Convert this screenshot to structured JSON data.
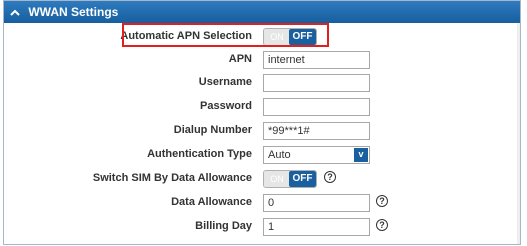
{
  "section": {
    "title": "WWAN Settings",
    "collapse_icon": "chevron-up-icon"
  },
  "rows": {
    "auto_apn": {
      "label": "Automatic APN Selection",
      "toggle_on": "ON",
      "toggle_off": "OFF",
      "state": "OFF"
    },
    "apn": {
      "label": "APN",
      "value": "internet"
    },
    "username": {
      "label": "Username",
      "value": ""
    },
    "password": {
      "label": "Password",
      "value": ""
    },
    "dialup": {
      "label": "Dialup Number",
      "value": "*99***1#"
    },
    "auth": {
      "label": "Authentication Type",
      "value": "Auto",
      "arrow": "v"
    },
    "switch_sim": {
      "label": "Switch SIM By Data Allowance",
      "toggle_on": "ON",
      "toggle_off": "OFF",
      "state": "OFF",
      "help": "?"
    },
    "data_allowance": {
      "label": "Data Allowance",
      "value": "0",
      "help": "?"
    },
    "billing_day": {
      "label": "Billing Day",
      "value": "1",
      "help": "?"
    }
  },
  "colors": {
    "header": "#1a5fa0",
    "toggle_off": "#1a5fa0",
    "highlight": "#e01f1f"
  }
}
